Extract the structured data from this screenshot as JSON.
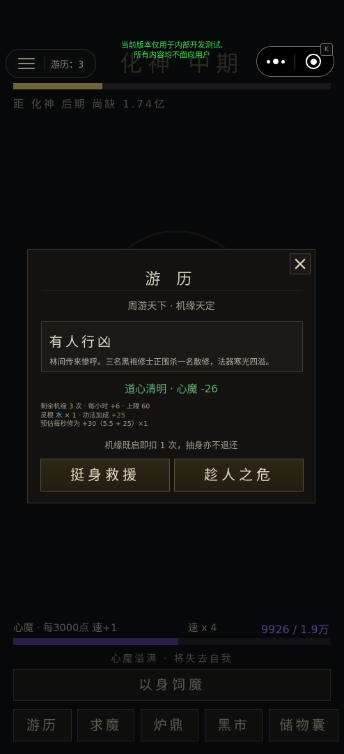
{
  "header": {
    "dev_notice_line1": "当前版本仅用于内部开发测试,",
    "dev_notice_line2": "所有内容均不面向用户",
    "realm_title": "化神 中期",
    "journey_label": "游历：3",
    "remaining": "距 化神 后期 尚缺 1.74亿",
    "realm_progress": 0.28,
    "badge_text": "K"
  },
  "modal": {
    "title": "游 历",
    "subtitle": "周游天下 · 机缘天定",
    "event": {
      "title": "有人行凶",
      "description": "林间传来惨呼。三名黑袍修士正围杀一名散修，法器寒光四溢。"
    },
    "outcome": "道心清明 · 心魔 -26",
    "stats": {
      "line1_prefix": "剩余机缘 ",
      "line1_count": "3",
      "line1_suffix": " 次 · 每小时 +6 · 上限 60",
      "line2_prefix": "灵根 ",
      "line2_root": "水",
      "line2_mid": " × ",
      "line2_mult": "1",
      "line2_text": " · 功法加成 ",
      "line2_bonus": "+25",
      "line3": "预估每秒修为 +30（5.5 + 25）×1"
    },
    "hint": "机缘既启即扣 1 次，抽身亦不退还",
    "choice_left": "挺身救援",
    "choice_right": "趁人之危"
  },
  "demon": {
    "label": "心魔 · 每3000点 速+1",
    "speed": "速 x 4",
    "count": "9926 / 1.9万",
    "fill": 0.52,
    "warning": "心魔溢满 · 将失去自我",
    "feed_button": "以身饲魔"
  },
  "nav": [
    "游历",
    "求魔",
    "炉鼎",
    "黑市",
    "储物囊"
  ],
  "colors": {
    "accent_gold": "#6e6236",
    "demon_purple": "#5a3e86",
    "outcome_green": "#5fb374"
  }
}
